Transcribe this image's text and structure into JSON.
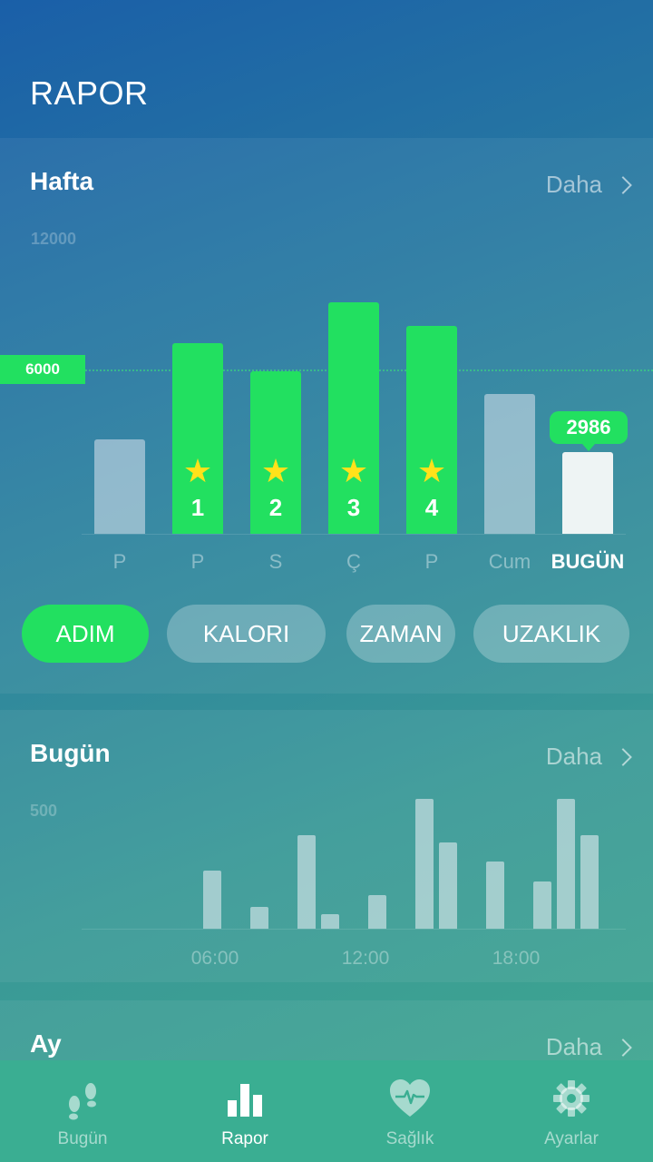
{
  "header": {
    "title": "RAPOR"
  },
  "week": {
    "title": "Hafta",
    "more_label": "Daha",
    "y_max_label": "12000",
    "goal_label": "6000",
    "today_value": "2986",
    "star_labels": [
      "1",
      "2",
      "3",
      "4"
    ],
    "day_labels": [
      "P",
      "P",
      "S",
      "Ç",
      "P",
      "Cum",
      "BUGÜN"
    ]
  },
  "metric_tabs": [
    "ADIM",
    "KALORI",
    "ZAMAN",
    "UZAKLIK"
  ],
  "today": {
    "title": "Bugün",
    "more_label": "Daha",
    "y_max_label": "500",
    "time_labels": [
      "06:00",
      "12:00",
      "18:00"
    ]
  },
  "month": {
    "title": "Ay",
    "more_label": "Daha"
  },
  "tabbar": [
    {
      "label": "Bugün",
      "icon": "footprints-icon"
    },
    {
      "label": "Rapor",
      "icon": "bar-chart-icon"
    },
    {
      "label": "Sağlık",
      "icon": "heart-pulse-icon"
    },
    {
      "label": "Ayarlar",
      "icon": "gear-icon"
    }
  ],
  "colors": {
    "accent": "#22e060",
    "star": "#ffe21a",
    "tabbar": "#3aae92"
  },
  "chart_data": [
    {
      "type": "bar",
      "categories": [
        "P",
        "P",
        "S",
        "Ç",
        "P",
        "Cum",
        "BUGÜN"
      ],
      "values": [
        3450,
        6950,
        5950,
        8450,
        7600,
        5100,
        2986
      ],
      "goal": 6000,
      "goal_met": [
        false,
        true,
        true,
        true,
        true,
        false,
        false
      ],
      "ylim": [
        0,
        12000
      ],
      "grid": false
    },
    {
      "type": "bar",
      "x": [
        "04:30",
        "06:00",
        "07:00",
        "08:30",
        "09:00",
        "10:30",
        "12:00",
        "13:00",
        "13:30",
        "15:00",
        "16:00",
        "17:00",
        "17:30",
        "18:30"
      ],
      "values": [
        0,
        240,
        90,
        390,
        60,
        140,
        540,
        360,
        0,
        280,
        195,
        540,
        390,
        0
      ],
      "ylim": [
        0,
        540
      ],
      "grid": false
    }
  ]
}
